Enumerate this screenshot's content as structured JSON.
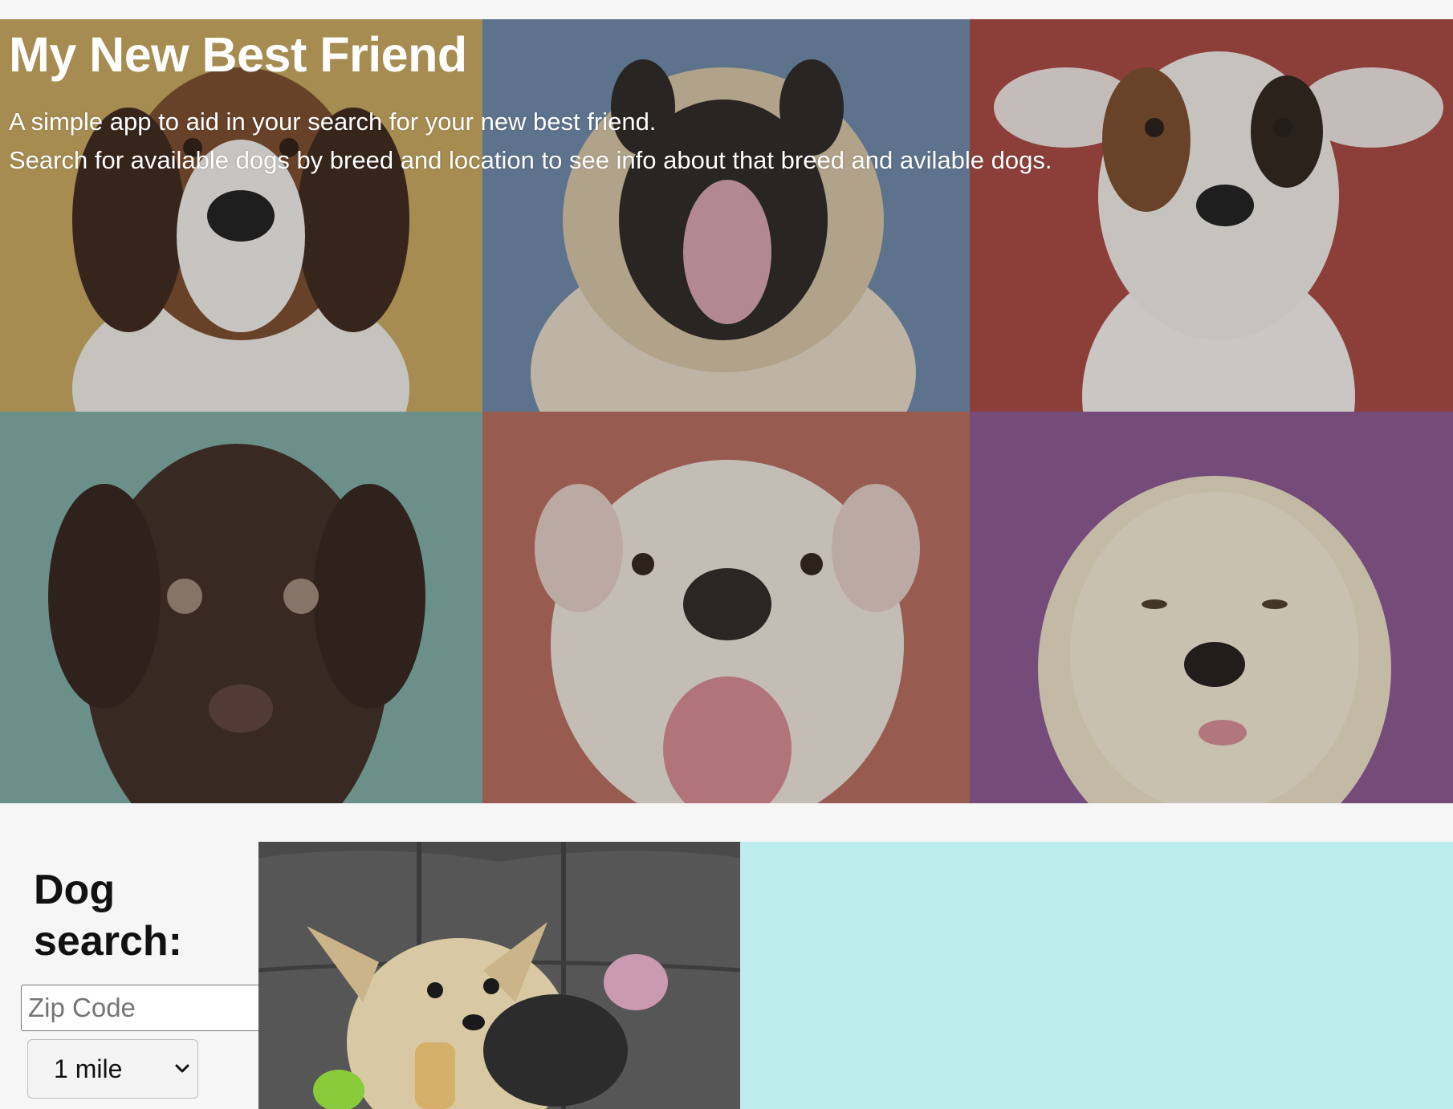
{
  "hero": {
    "title": "My New Best Friend",
    "subtitle_line1": "A simple app to aid in your search for your new best friend.",
    "subtitle_line2": "Search for available dogs by breed and location to see info about that breed and avilable dogs.",
    "tile_colors": [
      "#c8a85a",
      "#6a86a8",
      "#a44a42",
      "#7aaba2",
      "#b9685a",
      "#8a5590"
    ]
  },
  "search": {
    "heading": "Dog search:",
    "zip_placeholder": "Zip Code",
    "radius_selected": "1 mile"
  },
  "colors": {
    "info_panel": "#bdeced",
    "page_background": "#f6f6f6"
  }
}
